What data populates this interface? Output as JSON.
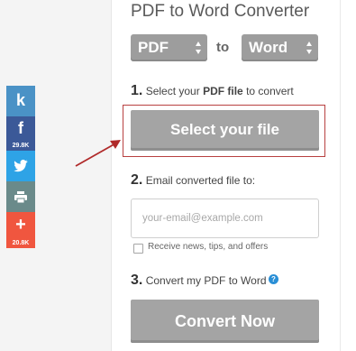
{
  "header": {
    "title": "PDF to Word Converter"
  },
  "format": {
    "from": "PDF",
    "to_label": "to",
    "to": "Word"
  },
  "step1": {
    "number": "1.",
    "text_before": "Select your ",
    "text_bold": "PDF file",
    "text_after": " to convert",
    "button_label": "Select your file"
  },
  "step2": {
    "number": "2.",
    "text": "Email converted file to:",
    "email_placeholder": "your-email@example.com",
    "checkbox_label": "Receive news, tips, and offers"
  },
  "step3": {
    "number": "3.",
    "text": "Convert my PDF to Word",
    "help_glyph": "?",
    "button_label": "Convert Now"
  },
  "share": {
    "kik": {
      "glyph": "k",
      "icon": "kik-icon"
    },
    "facebook": {
      "glyph": "f",
      "count": "29.8K",
      "icon": "facebook-icon"
    },
    "twitter": {
      "icon": "twitter-icon"
    },
    "print": {
      "icon": "print-icon"
    },
    "more": {
      "glyph": "+",
      "count": "20.8K",
      "icon": "plus-icon"
    }
  },
  "colors": {
    "button_gray": "#a4a4a4",
    "highlight": "#b84040",
    "help_blue": "#2a8fd6"
  }
}
